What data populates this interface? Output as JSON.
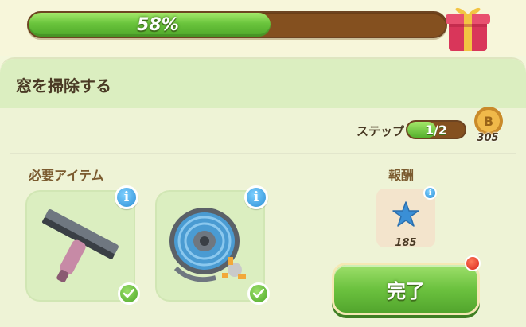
{
  "progress": {
    "percent_label": "58%",
    "value": 0.58
  },
  "task": {
    "title": "窓を掃除する",
    "steps_label": "ステップ",
    "steps_value": "1/2",
    "steps_fraction": 0.5,
    "coins": "305"
  },
  "required": {
    "label": "必要アイテム",
    "items": [
      {
        "name": "squeegee",
        "icon": "squeegee-icon",
        "info": "i",
        "complete": true
      },
      {
        "name": "garden-hose-reel",
        "icon": "hose-reel-icon",
        "info": "i",
        "complete": true
      }
    ]
  },
  "reward": {
    "label": "報酬",
    "value": "185",
    "icon": "blue-star-icon",
    "info": "i"
  },
  "actions": {
    "complete_label": "完了"
  },
  "colors": {
    "accent_green": "#6ac43c",
    "bar_brown": "#84501f",
    "info_blue": "#2c8fd6",
    "alert_red": "#d8241a"
  }
}
